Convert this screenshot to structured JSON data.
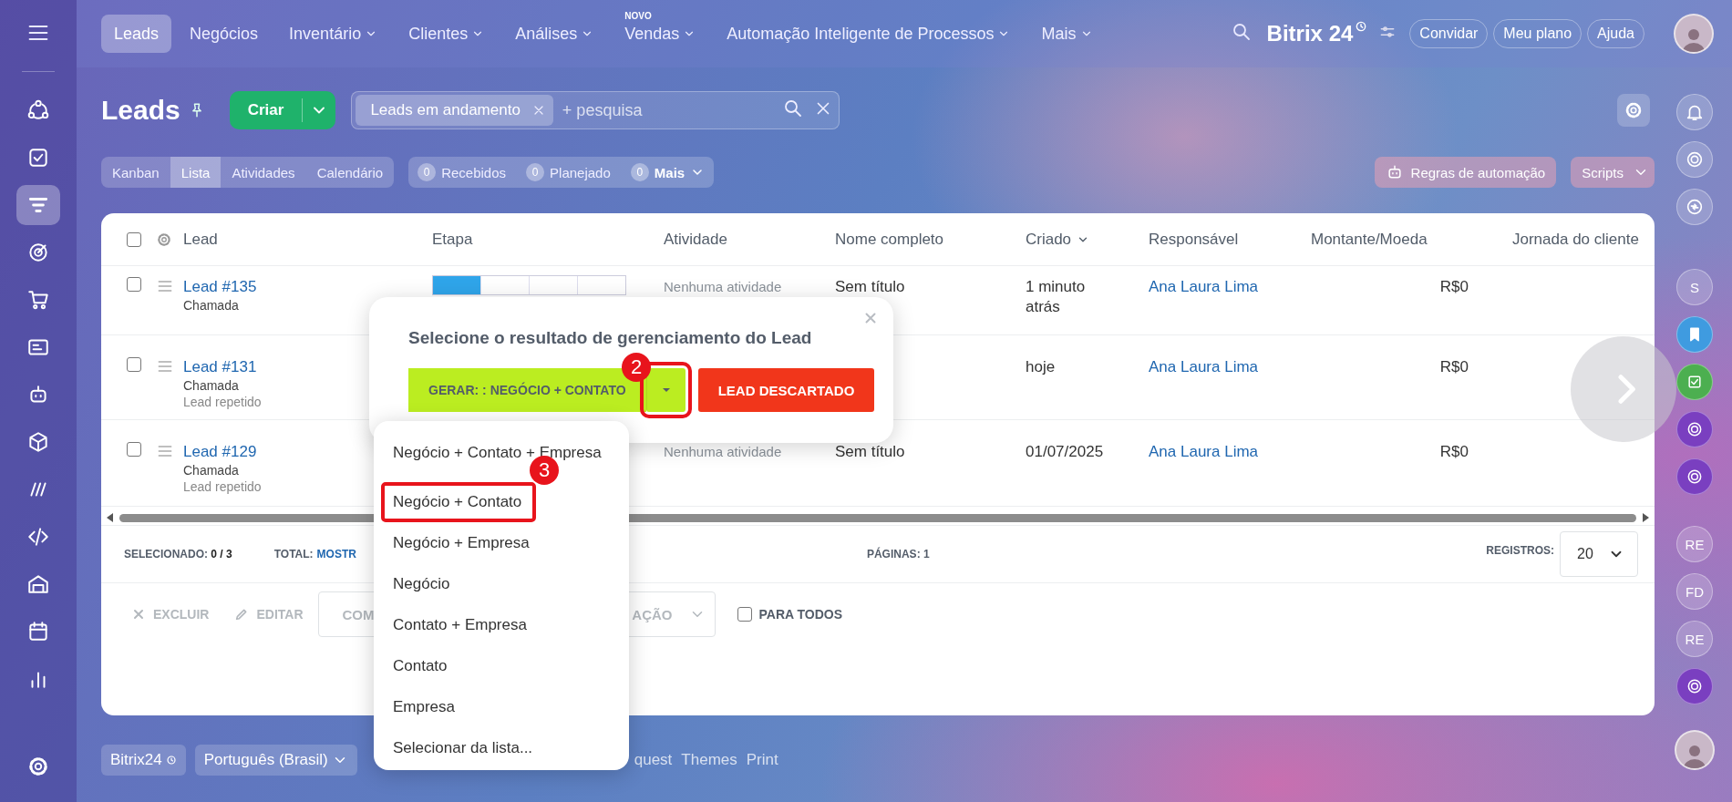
{
  "topbar": {
    "nav": [
      {
        "label": "Leads",
        "selected": true,
        "dropdown": false
      },
      {
        "label": "Negócios",
        "selected": false,
        "dropdown": false
      },
      {
        "label": "Inventário",
        "selected": false,
        "dropdown": true
      },
      {
        "label": "Clientes",
        "selected": false,
        "dropdown": true
      },
      {
        "label": "Análises",
        "selected": false,
        "dropdown": true
      },
      {
        "label": "Vendas",
        "selected": false,
        "dropdown": true,
        "badge": "NOVO"
      },
      {
        "label": "Automação Inteligente de Processos",
        "selected": false,
        "dropdown": true
      },
      {
        "label": "Mais",
        "selected": false,
        "dropdown": true
      }
    ],
    "logo": "Bitrix 24",
    "buttons": [
      "Convidar",
      "Meu plano",
      "Ajuda"
    ]
  },
  "sidebar": {
    "items": [
      {
        "selected": false
      },
      {
        "selected": false
      },
      {
        "selected": true
      },
      {
        "selected": false
      },
      {
        "selected": false
      },
      {
        "selected": false
      },
      {
        "selected": false
      },
      {
        "selected": false
      },
      {
        "selected": false
      },
      {
        "selected": false
      },
      {
        "selected": false
      },
      {
        "selected": false
      },
      {
        "selected": false
      }
    ]
  },
  "header": {
    "title": "Leads",
    "create": "Criar",
    "filter_chip": "Leads em andamento",
    "search_placeholder": "+ pesquisa"
  },
  "view_tabs": [
    {
      "label": "Kanban",
      "selected": false
    },
    {
      "label": "Lista",
      "selected": true
    },
    {
      "label": "Atividades",
      "selected": false
    },
    {
      "label": "Calendário",
      "selected": false
    }
  ],
  "counters": [
    {
      "count": "0",
      "label": "Recebidos",
      "dropdown": false
    },
    {
      "count": "0",
      "label": "Planejado",
      "dropdown": false
    },
    {
      "count": "0",
      "label": "Mais",
      "dropdown": true
    }
  ],
  "automation_button": "Regras de automação",
  "scripts_button": "Scripts",
  "table": {
    "header_checked": false,
    "columns": [
      {
        "label": "Lead",
        "sorted": false
      },
      {
        "label": "Etapa",
        "sorted": false
      },
      {
        "label": "Atividade",
        "sorted": false
      },
      {
        "label": "Nome completo",
        "sorted": false
      },
      {
        "label": "Criado",
        "sorted": true
      },
      {
        "label": "Responsável",
        "sorted": false
      },
      {
        "label": "Montante/Moeda",
        "sorted": false
      },
      {
        "label": "Jornada do cliente",
        "sorted": false
      }
    ],
    "rows": [
      {
        "checked": false,
        "lead": "Lead #135",
        "source": "Chamada",
        "level": 0.25,
        "activity": "Nenhuma atividade",
        "name": "Sem título",
        "created": "1 minuto atrás",
        "responsible": "Ana Laura Lima",
        "amount": "R$0"
      },
      {
        "checked": false,
        "lead": "Lead #131",
        "source": "Chamada",
        "note": "Lead repetido",
        "created": "hoje",
        "responsible": "Ana Laura Lima",
        "amount": "R$0"
      },
      {
        "checked": false,
        "lead": "Lead #129",
        "source": "Chamada",
        "note": "Lead repetido",
        "activity": "Nenhuma atividade",
        "name": "Sem título",
        "created": "01/07/2025",
        "responsible": "Ana Laura Lima",
        "amount": "R$0"
      }
    ]
  },
  "stats": {
    "selected_label": "SELECIONADO:",
    "selected_value": "0 / 3",
    "total_label": "TOTAL:",
    "total_link": "MOSTR",
    "pages_label": "PÁGINAS:",
    "pages_value": "1",
    "records_label": "REGISTROS:",
    "records_value": "20"
  },
  "actions": {
    "delete": {
      "label": "EXCLUIR",
      "disabled": true
    },
    "edit": {
      "label": "EDITAR",
      "disabled": true
    },
    "select_start": "COM",
    "select_end": "AÇÃO",
    "for_all": {
      "label": "PARA TODOS",
      "checked": false
    }
  },
  "footer": {
    "brand": "Bitrix24",
    "language": "Português (Brasil)",
    "links": [
      "quest",
      "Themes",
      "Print"
    ]
  },
  "right_rail": [
    {
      "kind": "bell"
    },
    {
      "kind": "copilot"
    },
    {
      "kind": "chat"
    },
    {
      "kind": "initials",
      "text": "S"
    },
    {
      "kind": "bookmark",
      "color": "#3f9be0"
    },
    {
      "kind": "task",
      "color": "#4caf50"
    },
    {
      "kind": "app",
      "color": "#7a3fc0"
    },
    {
      "kind": "app",
      "color": "#7a3fc0"
    },
    {
      "kind": "initials",
      "text": "RE"
    },
    {
      "kind": "initials",
      "text": "FD"
    },
    {
      "kind": "initials",
      "text": "RE"
    },
    {
      "kind": "app",
      "color": "#7a3fc0"
    },
    {
      "kind": "avatar"
    }
  ],
  "dialog": {
    "title": "Selecione o resultado de gerenciamento do Lead",
    "convert_button": "GERAR: : NEGÓCIO + CONTATO",
    "caret_highlighted": true,
    "reject_button": "LEAD DESCARTADO"
  },
  "menu": [
    {
      "label": "Negócio + Contato + Empresa",
      "highlighted": false
    },
    {
      "label": "Negócio + Contato",
      "highlighted": true
    },
    {
      "label": "Negócio + Empresa",
      "highlighted": false
    },
    {
      "label": "Negócio",
      "highlighted": false
    },
    {
      "label": "Contato + Empresa",
      "highlighted": false
    },
    {
      "label": "Contato",
      "highlighted": false
    },
    {
      "label": "Empresa",
      "highlighted": false
    },
    {
      "label": "Selecionar da lista...",
      "highlighted": false
    }
  ],
  "annotations": [
    {
      "label": "2"
    },
    {
      "label": "3"
    }
  ]
}
